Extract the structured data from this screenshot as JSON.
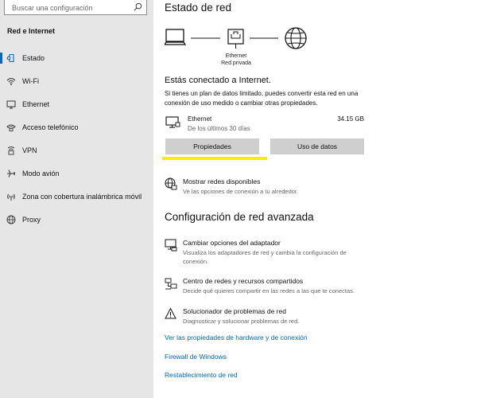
{
  "search": {
    "placeholder": "Buscar una configuración"
  },
  "sidebar": {
    "title": "Red e Internet",
    "items": [
      {
        "label": "Estado",
        "icon": "home-icon"
      },
      {
        "label": "Wi-Fi",
        "icon": "wifi-icon"
      },
      {
        "label": "Ethernet",
        "icon": "ethernet-icon"
      },
      {
        "label": "Acceso telefónico",
        "icon": "dialup-icon"
      },
      {
        "label": "VPN",
        "icon": "vpn-icon"
      },
      {
        "label": "Modo avión",
        "icon": "airplane-icon"
      },
      {
        "label": "Zona con cobertura inalámbrica móvil",
        "icon": "hotspot-icon"
      },
      {
        "label": "Proxy",
        "icon": "globe-icon"
      }
    ],
    "active_index": 0
  },
  "main": {
    "status_title": "Estado de red",
    "diagram": {
      "device_name": "Ethernet",
      "network_type": "Red privada"
    },
    "connected_heading": "Estás conectado a Internet.",
    "connected_desc": "Si tienes un plan de datos limitado, puedes convertir esta red en una conexión de uso medido o cambiar otras propiedades.",
    "connection": {
      "name": "Ethernet",
      "period": "De los últimos 30 días",
      "usage": "34.15 GB"
    },
    "buttons": {
      "properties": "Propiedades",
      "data_usage": "Uso de datos"
    },
    "show_networks": {
      "title": "Mostrar redes disponibles",
      "desc": "Ve las opciones de conexión a tu alrededor."
    },
    "advanced_title": "Configuración de red avanzada",
    "advanced_items": [
      {
        "title": "Cambiar opciones del adaptador",
        "desc": "Visualiza los adaptadores de red y cambia la configuración de conexión.",
        "icon": "adapter-icon"
      },
      {
        "title": "Centro de redes y recursos compartidos",
        "desc": "Decide qué quieres compartir en las redes a las que te conectas.",
        "icon": "sharing-icon"
      },
      {
        "title": "Solucionador de problemas de red",
        "desc": "Diagnosticar y solucionar problemas de red.",
        "icon": "warning-icon"
      }
    ],
    "links": [
      "Ver las propiedades de hardware y de conexión",
      "Firewall de Windows",
      "Restablecimiento de red"
    ]
  },
  "colors": {
    "accent": "#0067c0",
    "sidebar_bg": "#e6e6e6",
    "button_bg": "#cfcfcf",
    "highlight": "#ffeb00"
  }
}
